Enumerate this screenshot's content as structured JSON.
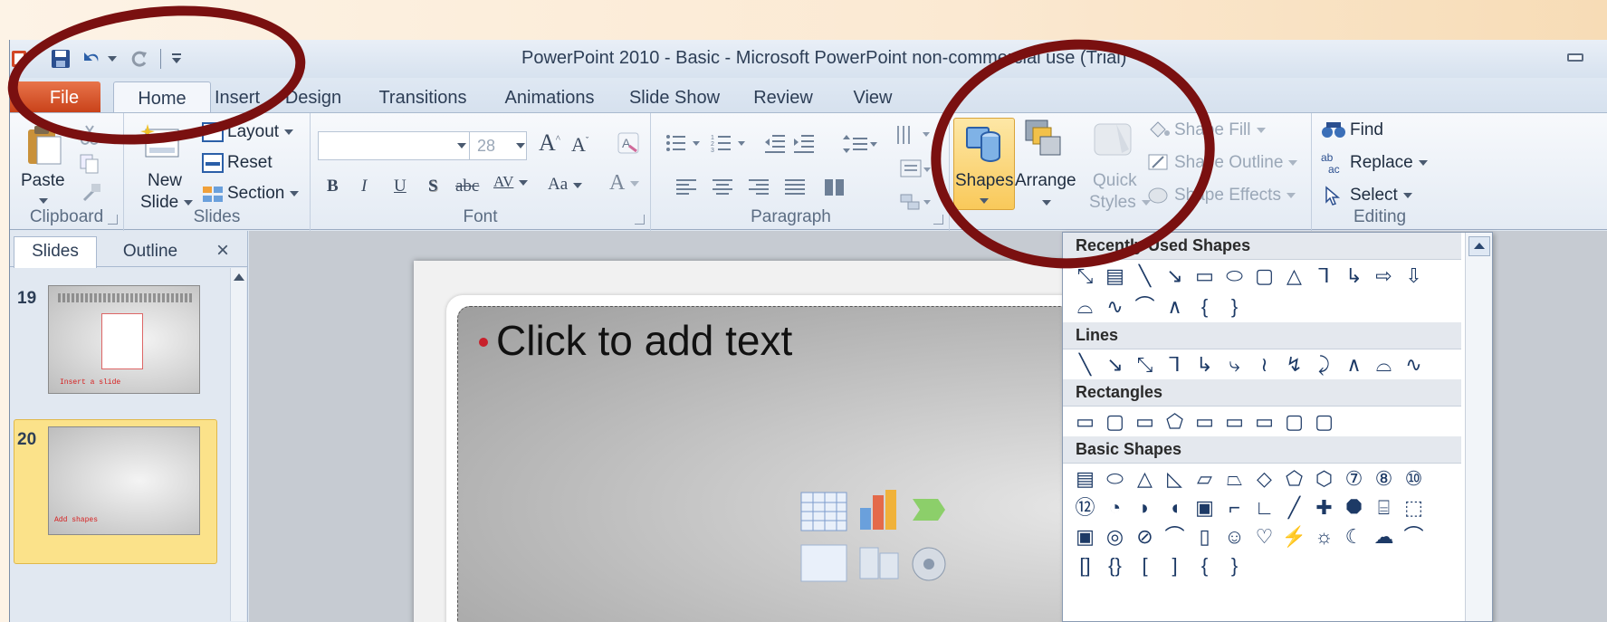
{
  "window": {
    "title": "PowerPoint 2010 - Basic  -  Microsoft PowerPoint non-commercial use (Trial)"
  },
  "qat": {
    "icons": [
      "powerpoint-logo-icon",
      "save-icon",
      "undo-icon",
      "redo-icon",
      "customize-qat-icon"
    ]
  },
  "tabs": [
    "File",
    "Home",
    "Insert",
    "Design",
    "Transitions",
    "Animations",
    "Slide Show",
    "Review",
    "View"
  ],
  "ribbon": {
    "clipboard": {
      "label": "Clipboard",
      "paste": "Paste"
    },
    "slides": {
      "label": "Slides",
      "new_slide_1": "New",
      "new_slide_2": "Slide",
      "layout": "Layout",
      "reset": "Reset",
      "section": "Section"
    },
    "font": {
      "label": "Font",
      "font_name": "",
      "font_size": "28",
      "bold": "B",
      "italic": "I",
      "underline": "U",
      "shadow": "S",
      "strike": "abc",
      "spacing": "AV",
      "case": "Aa",
      "color": "A"
    },
    "paragraph": {
      "label": "Paragraph"
    },
    "drawing": {
      "shapes": "Shapes",
      "arrange": "Arrange",
      "quick_1": "Quick",
      "quick_2": "Styles",
      "fill": "Shape Fill",
      "outline": "Shape Outline",
      "effects": "Shape Effects"
    },
    "editing": {
      "label": "Editing",
      "find": "Find",
      "replace": "Replace",
      "select": "Select"
    }
  },
  "pane": {
    "tab_slides": "Slides",
    "tab_outline": "Outline",
    "close": "×",
    "slides": [
      {
        "number": "19",
        "caption": "Insert a slide"
      },
      {
        "number": "20",
        "caption": "Add shapes"
      }
    ]
  },
  "slide": {
    "placeholder": "Click to add text"
  },
  "shapes_menu": {
    "sections": [
      {
        "title": "Recently Used Shapes",
        "rows": [
          [
            "⤡",
            "▤",
            "╲",
            "↘",
            "▭",
            "⬭",
            "▢",
            "△",
            "⅂",
            "↳",
            "⇨",
            "⇩"
          ],
          [
            "⌓",
            "∿",
            "⌒",
            "∧",
            "{",
            "}"
          ]
        ]
      },
      {
        "title": "Lines",
        "rows": [
          [
            "╲",
            "↘",
            "⤡",
            "⅂",
            "↳",
            "⤷",
            "≀",
            "↯",
            "⤸",
            "∧",
            "⌓",
            "∿"
          ]
        ]
      },
      {
        "title": "Rectangles",
        "rows": [
          [
            "▭",
            "▢",
            "▭",
            "⬠",
            "▭",
            "▭",
            "▭",
            "▢",
            "▢"
          ]
        ]
      },
      {
        "title": "Basic Shapes",
        "rows": [
          [
            "▤",
            "⬭",
            "△",
            "◺",
            "▱",
            "⏢",
            "◇",
            "⬠",
            "⬡",
            "⑦",
            "⑧",
            "⑩"
          ],
          [
            "⑫",
            "◔",
            "◗",
            "◖",
            "▣",
            "⌐",
            "∟",
            "╱",
            "✚",
            "⯃",
            "⌸",
            "⬚"
          ],
          [
            "▣",
            "◎",
            "⊘",
            "⌒",
            "▯",
            "☺",
            "♡",
            "⚡",
            "☼",
            "☾",
            "☁",
            "⌒"
          ],
          [
            "[]",
            "{}",
            "[",
            "]",
            "{",
            "}"
          ]
        ]
      }
    ]
  },
  "colors": {
    "accent_file_tab": "#c9421a",
    "shapes_highlight": "#f9c95a",
    "annotation_circle": "#7a1010",
    "bullet": "#c8202b"
  }
}
